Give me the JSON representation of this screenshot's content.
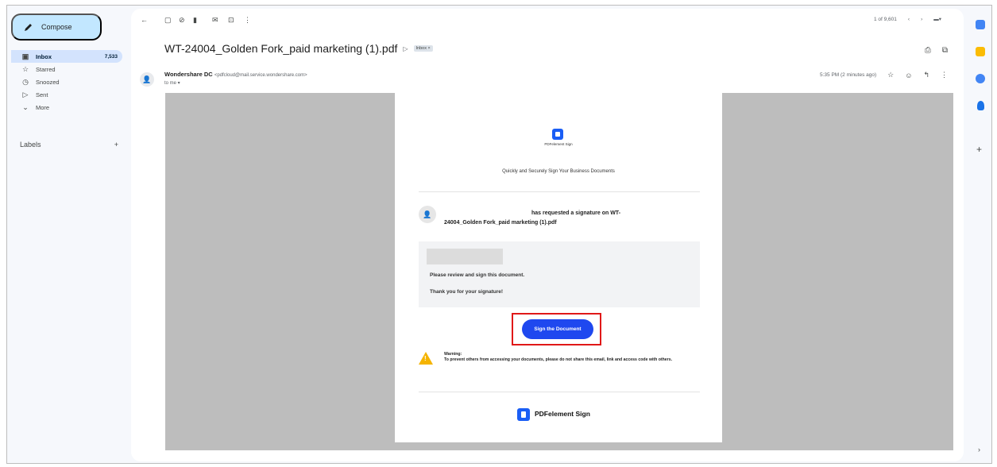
{
  "nav": {
    "compose": "Compose",
    "items": [
      {
        "label": "Inbox",
        "count": "7,533",
        "icon": "inbox-icon"
      },
      {
        "label": "Starred",
        "icon": "star-icon"
      },
      {
        "label": "Snoozed",
        "icon": "clock-icon"
      },
      {
        "label": "Sent",
        "icon": "send-icon"
      },
      {
        "label": "More",
        "icon": "chevron-down-icon"
      }
    ],
    "labels_title": "Labels",
    "labels_add": "+"
  },
  "toolbar": {
    "pager_text": "1 of 9,601",
    "icons": [
      "back-icon",
      "archive-icon",
      "report-icon",
      "delete-icon",
      "mark-unread-icon",
      "move-to-icon",
      "more-icon"
    ]
  },
  "message": {
    "subject": "WT-24004_Golden Fork_paid marketing (1).pdf",
    "inbox_chip": "Inbox ×",
    "sender_name": "Wondershare DC",
    "sender_email": "<pdfcloud@mail.service.wondershare.com>",
    "to": "to me ▾",
    "time": "5:35 PM (2 minutes ago)"
  },
  "email": {
    "brand_small": "PDFelement Sign",
    "tagline": "Quickly and Securely Sign Your Business Documents",
    "request_line1": "has requested a signature on WT-",
    "request_line2": "24004_Golden Fork_paid marketing (1).pdf",
    "msg1": "Please review and sign this document.",
    "msg2": "Thank you for your signature!",
    "sign_button": "Sign the Document",
    "warning_title": "Warning:",
    "warning_body": "To prevent others from accessing your documents, please do not share this email, link and access code with others.",
    "footer_brand": "PDFelement Sign"
  },
  "colors": {
    "accent_blue": "#1f48ef",
    "highlight_red": "#e01818",
    "warning_yellow": "#f5b400",
    "compose_bg": "#c2e7ff"
  }
}
